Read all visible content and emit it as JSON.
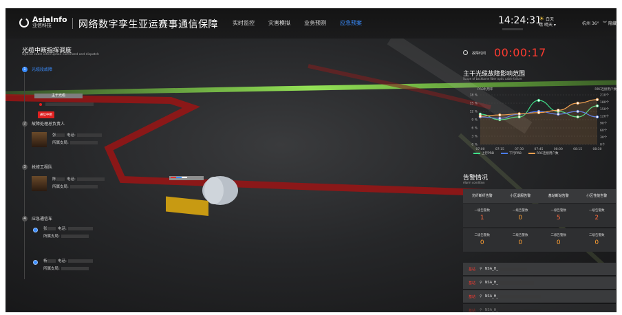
{
  "header": {
    "logo_en": "AsiaInfo",
    "logo_cn": "亚信科技",
    "title": "网络数字孪生亚运赛事通信保障",
    "nav": [
      {
        "label": "实时监控",
        "active": false
      },
      {
        "label": "灾害模拟",
        "active": false
      },
      {
        "label": "业务预测",
        "active": false
      },
      {
        "label": "应急预案",
        "active": true
      }
    ],
    "time": "14:24:31",
    "weather_top": "白天",
    "weather_bottom": "晴",
    "weather_state": "晴天",
    "city": "杭州",
    "temp": "36°",
    "hide_label": "隐藏"
  },
  "left_panel": {
    "title": "光缆中断指挥调度",
    "subtitle": "Optical cable interruption command and dispatch",
    "step1": {
      "num": "1",
      "label": "光缆段故障",
      "bar_label": "主干光缆",
      "badge": "通信中断"
    },
    "step2": {
      "num": "2",
      "label": "故障处理总负责人",
      "name_prefix": "张",
      "phone_label": "电话:",
      "dept_label": "所属支局:"
    },
    "step3": {
      "num": "3",
      "label": "抢修工程队",
      "name_prefix": "陈",
      "phone_label": "电话:",
      "dept_label": "所属支局:"
    },
    "step4": {
      "num": "4",
      "label": "应急通信车",
      "cars": [
        {
          "name_prefix": "张",
          "phone_label": "电话:",
          "dept_label": "所属支局:"
        },
        {
          "name_prefix": "杨",
          "phone_label": "电话:",
          "dept_label": "所属支局:"
        }
      ]
    }
  },
  "right_panel": {
    "timer_label": "故障时间",
    "timer": "00:00:17",
    "impact_title": "主干光缆故障影响范围",
    "impact_sub": "Scope of backbone fiber optic cable failure",
    "alarm_title": "告警情况",
    "alarm_sub": "Alarm condition",
    "alarm_headers": [
      "光纤断纤告警",
      "小区退服告警",
      "基站断站告警",
      "小区性能告警"
    ],
    "alarm_rows": [
      [
        {
          "label": "一级告警数",
          "value": "1"
        },
        {
          "label": "一级告警数",
          "value": "0"
        },
        {
          "label": "一级告警数",
          "value": "5"
        },
        {
          "label": "一级告警数",
          "value": "2"
        }
      ],
      [
        {
          "label": "二级告警数",
          "value": "0"
        },
        {
          "label": "二级告警数",
          "value": "0"
        },
        {
          "label": "二级告警数",
          "value": "0"
        },
        {
          "label": "二级告警数",
          "value": "0"
        }
      ]
    ],
    "alarm_list": [
      {
        "tag": "基站",
        "name": "NSA_H_"
      },
      {
        "tag": "基站",
        "name": "NSA_H_"
      },
      {
        "tag": "基站",
        "name": "NSA_H_"
      },
      {
        "tag": "基站",
        "name": "NSA_H_"
      }
    ]
  },
  "chart_data": {
    "type": "line",
    "ylabel_left": "PRB利用率",
    "ylabel_right": "RRC连接用户数",
    "categories": [
      "07:00",
      "07:15",
      "07:30",
      "07:45",
      "08:00",
      "08:15",
      "08:30"
    ],
    "left_ticks": [
      "0 %",
      "3 %",
      "6 %",
      "9 %",
      "12 %",
      "15 %",
      "18 %"
    ],
    "right_ticks": [
      "0个",
      "30个",
      "60个",
      "90个",
      "120个",
      "150个",
      "180个",
      "210个"
    ],
    "ylim_left": [
      0,
      18
    ],
    "ylim_right": [
      0,
      210
    ],
    "series": [
      {
        "name": "上行PRB",
        "axis": "left",
        "color": "#3fe08a",
        "values": [
          11,
          9,
          10,
          16,
          12,
          10,
          14
        ]
      },
      {
        "name": "下行PRB",
        "axis": "left",
        "color": "#4a7cff",
        "values": [
          10,
          9.5,
          11,
          12,
          11,
          12,
          10
        ]
      },
      {
        "name": "RRC连接用户数",
        "axis": "right",
        "color": "#f0a050",
        "values": [
          120,
          125,
          130,
          135,
          145,
          175,
          190
        ]
      }
    ]
  }
}
